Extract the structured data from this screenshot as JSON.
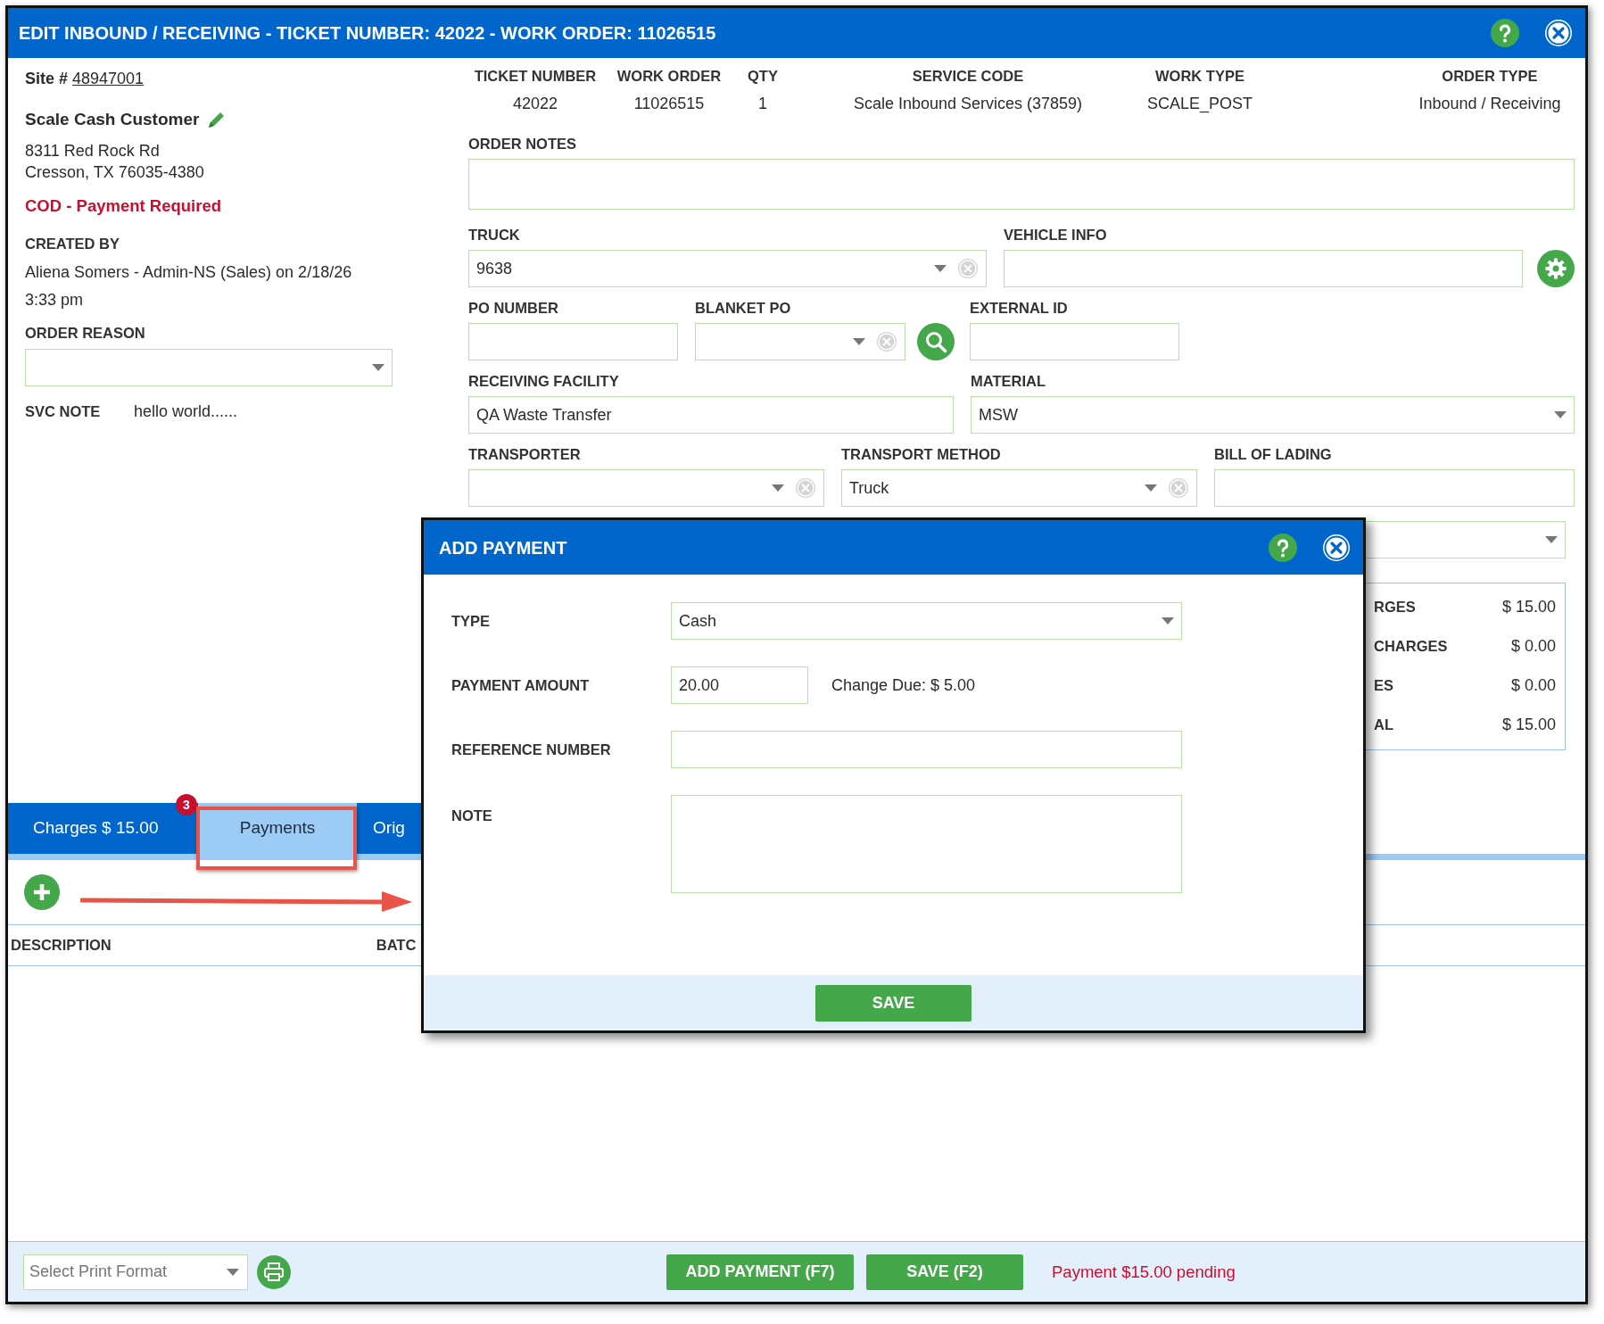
{
  "window": {
    "title": "EDIT INBOUND / RECEIVING - TICKET NUMBER: 42022 - WORK ORDER: 11026515"
  },
  "customer": {
    "site_label": "Site #",
    "site_number": "48947001",
    "name": "Scale Cash Customer",
    "address": [
      "8311 Red Rock Rd",
      "Cresson, TX 76035-4380"
    ],
    "payment_notice": "COD - Payment Required",
    "created_by_label": "CREATED BY",
    "created_by": [
      "Aliena Somers - Admin-NS (Sales) on 2/18/26",
      "3:33 pm"
    ],
    "order_reason": {
      "label": "ORDER REASON",
      "clearable": false
    },
    "svc_note": {
      "label": "SVC NOTE",
      "text": "hello world......"
    }
  },
  "summary": [
    {
      "label": "TICKET NUMBER",
      "value": "42022"
    },
    {
      "label": "WORK ORDER",
      "value": "11026515"
    },
    {
      "label": "QTY",
      "value": "1"
    },
    {
      "label": "SERVICE CODE",
      "value": "Scale Inbound Services (37859)"
    },
    {
      "label": "WORK TYPE",
      "value": "SCALE_POST"
    },
    {
      "label": "ORDER TYPE",
      "value": "Inbound / Receiving"
    }
  ],
  "form": {
    "rows": [
      [
        {
          "kind": "textarea",
          "label": "ORDER NOTES"
        }
      ],
      [
        {
          "kind": "select",
          "label": "TRUCK",
          "value": "9638",
          "clearable": true
        },
        {
          "kind": "input",
          "label": "VEHICLE INFO"
        },
        {
          "kind": "settings_button"
        }
      ],
      [
        {
          "kind": "input",
          "label": "PO NUMBER"
        },
        {
          "kind": "select",
          "label": "BLANKET PO",
          "clearable": true
        },
        {
          "kind": "search_button"
        },
        {
          "kind": "input",
          "label": "EXTERNAL ID"
        }
      ],
      [
        {
          "kind": "input",
          "label": "RECEIVING FACILITY",
          "value": "QA Waste Transfer"
        },
        {
          "kind": "select",
          "label": "MATERIAL",
          "value": "MSW",
          "clearable": false
        }
      ],
      [
        {
          "kind": "select",
          "label": "TRANSPORTER",
          "clearable": true
        },
        {
          "kind": "select",
          "label": "TRANSPORT METHOD",
          "value": "Truck",
          "clearable": true
        },
        {
          "kind": "input",
          "label": "BILL OF LADING"
        }
      ]
    ]
  },
  "side_panel": {
    "dropdown": {
      "clearable": false
    },
    "totals": [
      {
        "label": "RGES",
        "value": "$ 15.00"
      },
      {
        "label": "CHARGES",
        "value": "$ 0.00"
      },
      {
        "label": "ES",
        "value": "$ 0.00"
      },
      {
        "label": "AL",
        "value": "$ 15.00"
      }
    ]
  },
  "tabs": [
    {
      "label": "Charges $ 15.00",
      "badge": "3",
      "selected": false
    },
    {
      "label": "Payments",
      "selected": true
    },
    {
      "label": "Orig",
      "selected": false
    }
  ],
  "payments_table": {
    "columns": [
      "DESCRIPTION",
      "BATC"
    ]
  },
  "footer": {
    "print_format": {
      "placeholder": "Select Print Format"
    },
    "buttons": [
      "ADD PAYMENT (F7)",
      "SAVE (F2)"
    ],
    "status": "Payment $15.00 pending"
  },
  "dialog": {
    "title": "ADD PAYMENT",
    "fields": [
      {
        "kind": "select",
        "label": "TYPE",
        "value": "Cash"
      },
      {
        "kind": "amount",
        "label": "PAYMENT AMOUNT",
        "value": "20.00",
        "note": "Change Due: $ 5.00"
      },
      {
        "kind": "input",
        "label": "REFERENCE NUMBER"
      },
      {
        "kind": "textarea",
        "label": "NOTE"
      }
    ],
    "save": "SAVE"
  },
  "annotations": [
    {
      "kind": "frame"
    },
    {
      "kind": "arrow"
    }
  ]
}
